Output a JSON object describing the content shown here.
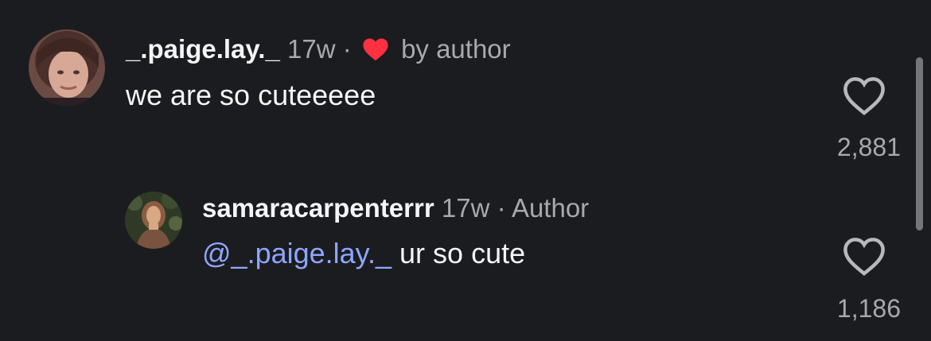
{
  "comments": [
    {
      "username": "_.paige.lay._",
      "age": "17w",
      "separator": "·",
      "liked_by_label": "by author",
      "text": "we are so cuteeeee",
      "like_count": "2,881",
      "avatar_icon": "profile-photo-avatar"
    }
  ],
  "replies": [
    {
      "username": "samaracarpenterrr",
      "age": "17w",
      "separator": "·",
      "role_label": "Author",
      "mention": "@_.paige.lay._",
      "text": " ur so cute",
      "like_count": "1,186",
      "avatar_icon": "profile-photo-avatar"
    }
  ],
  "colors": {
    "background": "#1b1c20",
    "text": "#f5f5f5",
    "muted": "#a8a8ad",
    "mention": "#8ea6ff",
    "heart_red": "#ff3040"
  },
  "icons": {
    "liked_heart": "heart-filled-icon",
    "like": "heart-outline-icon"
  }
}
